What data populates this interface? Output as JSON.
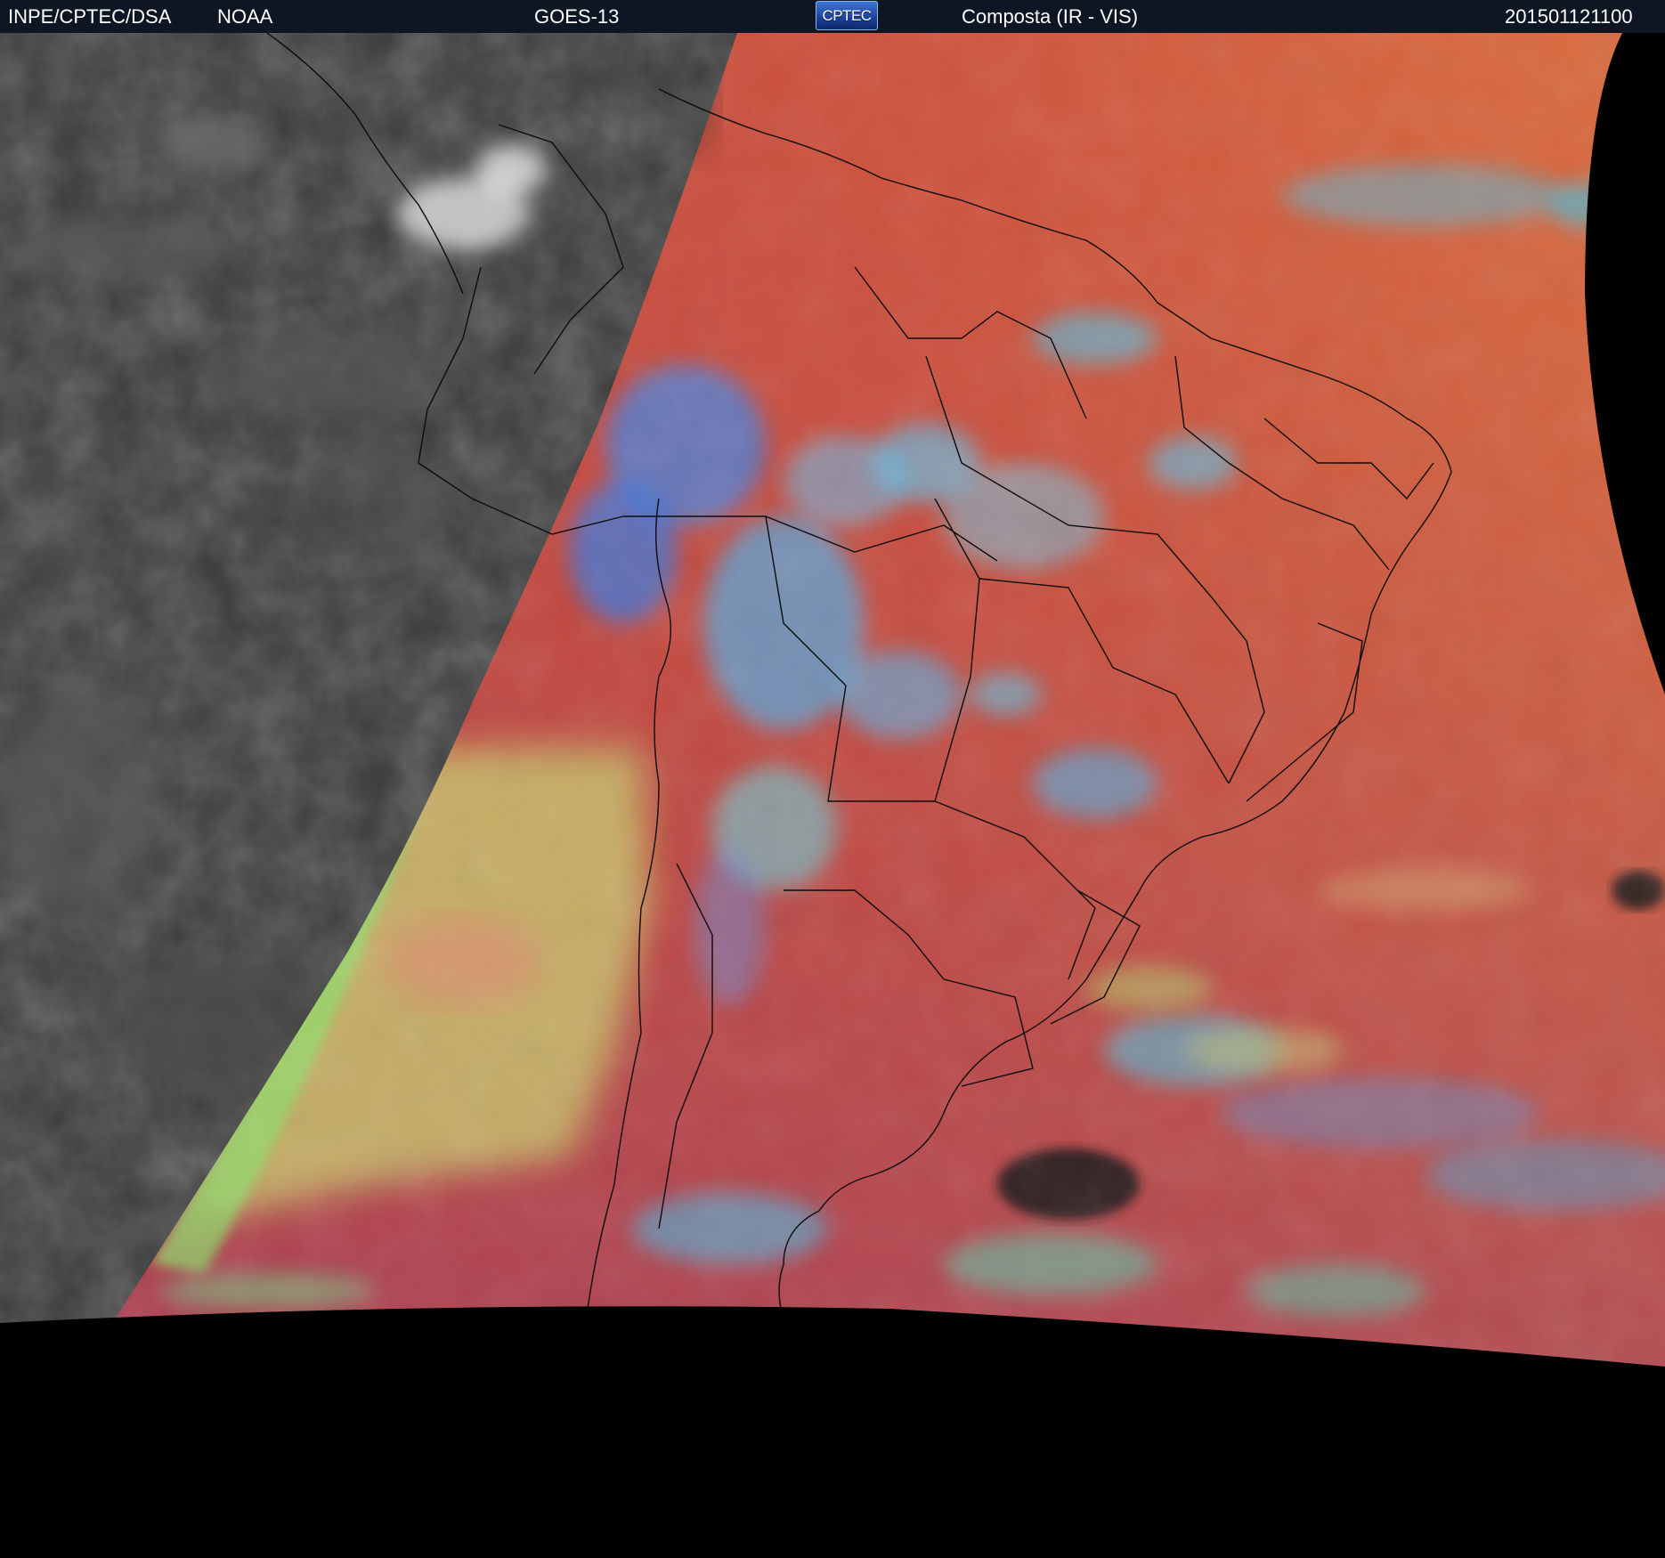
{
  "header": {
    "institution": "INPE/CPTEC/DSA",
    "agency": "NOAA",
    "satellite": "GOES-13",
    "logo_text": "CPTEC",
    "product": "Composta (IR - VIS)",
    "timestamp": "201501121100"
  },
  "colors": {
    "header_bg": "#0d1622",
    "night_side": "#3a3a3a",
    "land_red": "#c8463e",
    "ocean_orange": "#d8663e",
    "cloud_cyan": "#4fc0e6",
    "cloud_blue": "#4a86e0",
    "stratus_yellow_green": "#c9cf70",
    "outside_disk": "#000000"
  }
}
